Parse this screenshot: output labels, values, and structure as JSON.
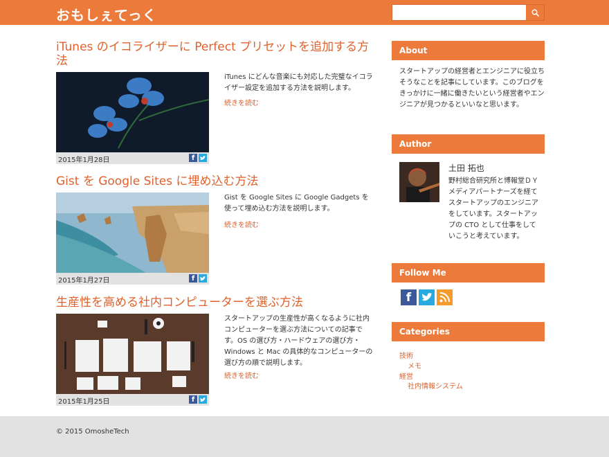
{
  "header": {
    "logo": "おもしぇてっく",
    "search_placeholder": "",
    "search_icon": "search-icon",
    "accent_color": "#ec7a3a"
  },
  "posts": [
    {
      "title": "iTunes のイコライザーに Perfect プリセットを追加する方法",
      "date": "2015年1月28日",
      "excerpt": "iTunes にどんな音楽にも対応した完璧なイコライザー設定を追加する方法を説明します。",
      "read_more": "続きを読む"
    },
    {
      "title": "Gist を Google Sites に埋め込む方法",
      "date": "2015年1月27日",
      "excerpt": "Gist を Google Sites に Google Gadgets を使って埋め込む方法を説明します。",
      "read_more": "続きを読む"
    },
    {
      "title": "生産性を高める社内コンピューターを選ぶ方法",
      "date": "2015年1月25日",
      "excerpt": "スタートアップの生産性が高くなるように社内コンピューターを選ぶ方法についての記事です。OS の選び方・ハードウェアの選び方・Windows と Mac の具体的なコンピューターの選び方の順で説明します。",
      "read_more": "続きを読む"
    }
  ],
  "sidebar": {
    "about": {
      "heading": "About",
      "text": "スタートアップの経営者とエンジニアに役立ちそうなことを記事にしています。このブログをきっかけに一緒に働きたいという経営者やエンジニアが見つかるといいなと思います。"
    },
    "author": {
      "heading": "Author",
      "name": "土田 拓也",
      "bio": "野村総合研究所と博報堂ＤＹメディアパートナーズを経てスタートアップのエンジニアをしています。スタートアップの CTO として仕事をしていこうと考えています。"
    },
    "follow": {
      "heading": "Follow Me",
      "icons": [
        "facebook-icon",
        "twitter-icon",
        "rss-icon"
      ]
    },
    "categories": {
      "heading": "Categories",
      "items": [
        {
          "label": "技術",
          "level": 1
        },
        {
          "label": "メモ",
          "level": 2
        },
        {
          "label": "経営",
          "level": 1
        },
        {
          "label": "社内情報システム",
          "level": 2
        }
      ]
    }
  },
  "footer": {
    "copyright": "© 2015 OmosheTech"
  }
}
